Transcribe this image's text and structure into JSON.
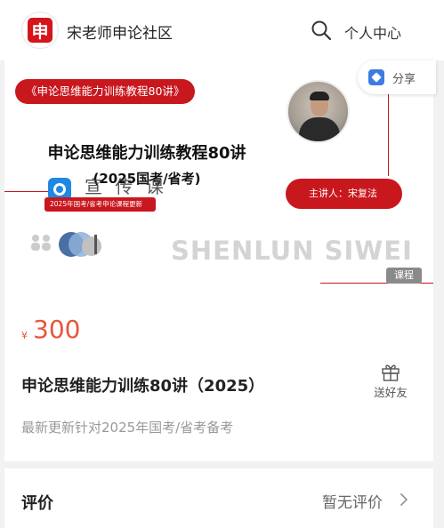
{
  "header": {
    "logo_char": "申",
    "site_title": "宋老师申论社区",
    "user_center": "个人中心"
  },
  "banner": {
    "pill": "《申论思维能力训练教程80讲》",
    "main_title": "申论思维能力训练教程80讲",
    "sub_title": "(2025国考/省考)",
    "speaker": "主讲人：宋复法",
    "watermark": "宣 传 课",
    "tag": "2025年国考/省考申论课程更新",
    "pinyin": "SHENLUN SIWEI",
    "badge": "课程",
    "share_label": "分享"
  },
  "course": {
    "currency": "¥",
    "price": "300",
    "title": "申论思维能力训练80讲（2025）",
    "gift_label": "送好友",
    "description": "最新更新针对2025年国考/省考备考"
  },
  "review": {
    "title": "评价",
    "status": "暂无评价"
  },
  "colors": {
    "brand_red": "#c9171e",
    "price_orange": "#e8553b"
  },
  "icons": [
    "search-icon",
    "share-icon",
    "gift-icon",
    "chevron-right-icon"
  ]
}
